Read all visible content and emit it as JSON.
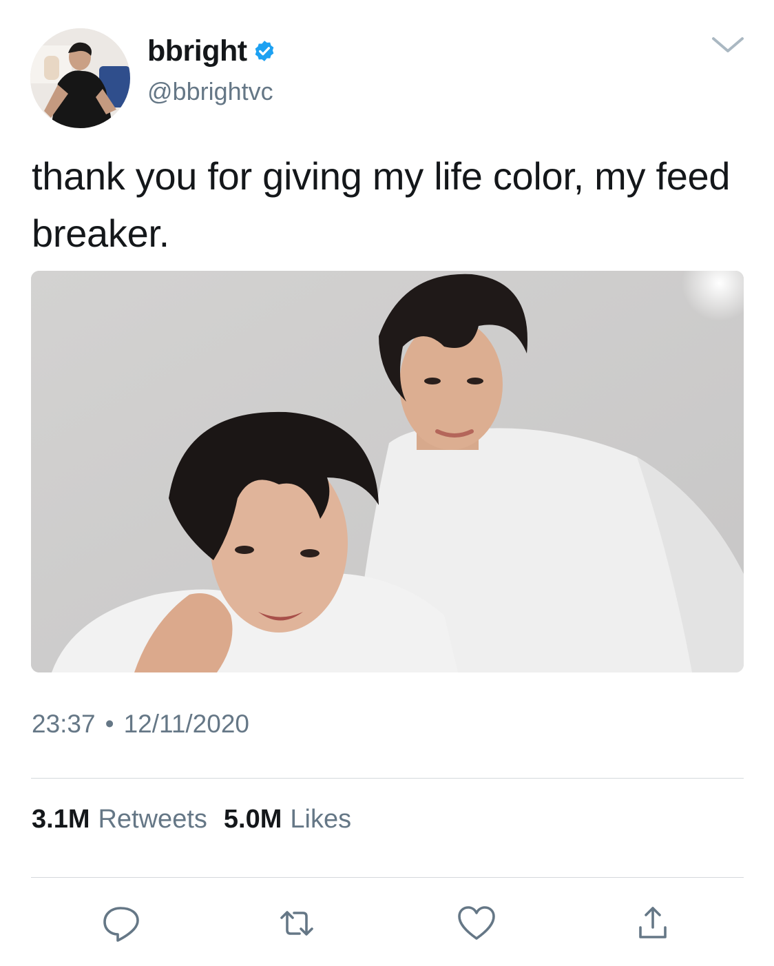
{
  "user": {
    "display_name": "bbright",
    "handle": "@bbrightvc",
    "verified": true,
    "verified_color": "#1da1f2"
  },
  "tweet": {
    "text": "thank you for giving my life color, my feed breaker.",
    "time": "23:37",
    "separator": "•",
    "date": "12/11/2020"
  },
  "stats": {
    "retweets_count": "3.1M",
    "retweets_label": "Retweets",
    "likes_count": "5.0M",
    "likes_label": "Likes"
  },
  "icons": {
    "menu": "chevron-down-icon",
    "reply": "reply-icon",
    "retweet": "retweet-icon",
    "like": "heart-icon",
    "share": "share-icon"
  },
  "colors": {
    "text": "#14171a",
    "secondary": "#657786",
    "divider": "#d4d8dc"
  }
}
